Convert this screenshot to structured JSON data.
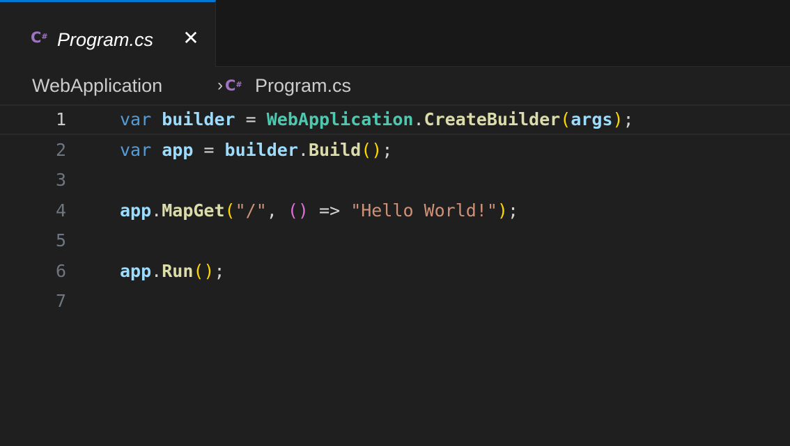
{
  "tab": {
    "icon_glyph": "C",
    "icon_sup": "#",
    "icon_name": "csharp-file-icon",
    "label": "Program.cs",
    "close_glyph": "✕"
  },
  "breadcrumb": {
    "folder": "WebApplication",
    "separator": "›",
    "file_icon_glyph": "C",
    "file_icon_sup": "#",
    "file": "Program.cs"
  },
  "editor": {
    "current_line": 1,
    "lines": [
      {
        "number": "1",
        "tokens": [
          {
            "t": "var",
            "c": "kw"
          },
          {
            "t": " ",
            "c": "op"
          },
          {
            "t": "builder",
            "c": "var"
          },
          {
            "t": " = ",
            "c": "op"
          },
          {
            "t": "WebApplication",
            "c": "type"
          },
          {
            "t": ".",
            "c": "op"
          },
          {
            "t": "CreateBuilder",
            "c": "meth"
          },
          {
            "t": "(",
            "c": "p1"
          },
          {
            "t": "args",
            "c": "var"
          },
          {
            "t": ")",
            "c": "p1"
          },
          {
            "t": ";",
            "c": "op"
          }
        ]
      },
      {
        "number": "2",
        "tokens": [
          {
            "t": "var",
            "c": "kw"
          },
          {
            "t": " ",
            "c": "op"
          },
          {
            "t": "app",
            "c": "var"
          },
          {
            "t": " = ",
            "c": "op"
          },
          {
            "t": "builder",
            "c": "var"
          },
          {
            "t": ".",
            "c": "op"
          },
          {
            "t": "Build",
            "c": "meth"
          },
          {
            "t": "()",
            "c": "p1"
          },
          {
            "t": ";",
            "c": "op"
          }
        ]
      },
      {
        "number": "3",
        "tokens": []
      },
      {
        "number": "4",
        "tokens": [
          {
            "t": "app",
            "c": "var"
          },
          {
            "t": ".",
            "c": "op"
          },
          {
            "t": "MapGet",
            "c": "meth"
          },
          {
            "t": "(",
            "c": "p1"
          },
          {
            "t": "\"/\"",
            "c": "str"
          },
          {
            "t": ", ",
            "c": "op"
          },
          {
            "t": "()",
            "c": "p2"
          },
          {
            "t": " => ",
            "c": "op"
          },
          {
            "t": "\"Hello World!\"",
            "c": "str"
          },
          {
            "t": ")",
            "c": "p1"
          },
          {
            "t": ";",
            "c": "op"
          }
        ]
      },
      {
        "number": "5",
        "tokens": []
      },
      {
        "number": "6",
        "tokens": [
          {
            "t": "app",
            "c": "var"
          },
          {
            "t": ".",
            "c": "op"
          },
          {
            "t": "Run",
            "c": "meth"
          },
          {
            "t": "()",
            "c": "p1"
          },
          {
            "t": ";",
            "c": "op"
          }
        ]
      },
      {
        "number": "7",
        "tokens": []
      }
    ]
  },
  "colors": {
    "background": "#1f1f1f",
    "tab_active_border": "#0078d4",
    "csharp_icon": "#a074c4",
    "keyword": "#569cd6",
    "variable": "#9cdcfe",
    "type": "#4ec9b0",
    "method": "#dcdcaa",
    "bracket_level1": "#ffd700",
    "bracket_level2": "#da70d6",
    "string": "#ce9178"
  }
}
